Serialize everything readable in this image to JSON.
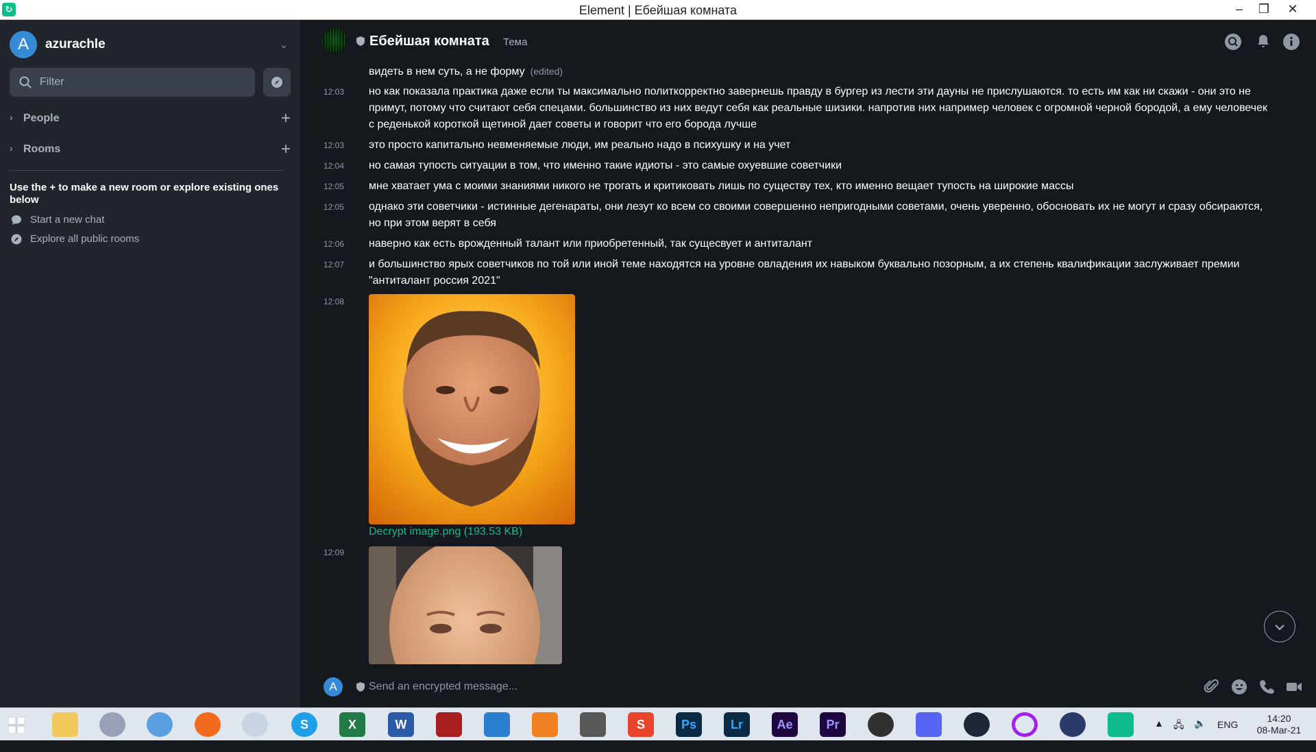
{
  "window": {
    "title": "Element | Ебейшая комната",
    "minimize": "–",
    "maximize": "❐",
    "close": "✕"
  },
  "sidebar": {
    "user": {
      "avatar_letter": "A",
      "name": "azurachle"
    },
    "filter_placeholder": "Filter",
    "sections": [
      {
        "label": "People"
      },
      {
        "label": "Rooms"
      }
    ],
    "hint": "Use the + to make a new room or explore existing ones below",
    "links": [
      {
        "label": "Start a new chat",
        "icon": "chat-bubble-icon"
      },
      {
        "label": "Explore all public rooms",
        "icon": "compass-icon"
      }
    ]
  },
  "room": {
    "name": "Ебейшая комната",
    "topic": "Тема"
  },
  "messages": [
    {
      "time": "",
      "text": "видеть в нем суть, а не форму",
      "edited": "(edited)"
    },
    {
      "time": "12:03",
      "text": "но как показала практика даже если ты максимально политкорректно завернешь правду в бургер из лести эти дауны не прислушаются. то есть им как ни скажи - они это не примут, потому что считают себя спецами. большинство из них ведут себя как реальные шизики. напротив них например человек с огромной черной бородой, а ему человечек с реденькой короткой щетиной дает советы и говорит что его борода лучше"
    },
    {
      "time": "12:03",
      "text": "это просто капитально невменяемые люди, им реально надо в психушку и на учет"
    },
    {
      "time": "12:04",
      "text": "но самая тупость ситуации в том, что именно такие идиоты - это самые охуевшие советчики"
    },
    {
      "time": "12:05",
      "text": "мне хватает ума с моими знаниями никого не трогать и критиковать лишь по существу тех, кто именно вещает тупость на широкие массы"
    },
    {
      "time": "12:05",
      "text": "однако эти советчики - истинные дегенараты, они лезут ко всем со своими совершенно непригодными советами, очень уверенно, обосновать их не могут и сразу обсираются, но при этом верят в себя"
    },
    {
      "time": "12:06",
      "text": "наверно как есть врожденный талант или приобретенный, так сущесвует и антиталант"
    },
    {
      "time": "12:07",
      "text": "и большинство ярых советчиков по той или иной теме находятся на уровне овладения их навыком буквально позорным, а их степень квалификации заслуживает премии \"антиталант россия 2021\""
    }
  ],
  "images": [
    {
      "time": "12:08",
      "link": "Decrypt image.png (193.53 KB)"
    },
    {
      "time": "12:09"
    }
  ],
  "composer": {
    "avatar_letter": "A",
    "placeholder": "Send an encrypted message..."
  },
  "taskbar": {
    "icons": [
      "windows-start-icon",
      "file-explorer-icon",
      "qbittorrent-icon",
      "internet-icon",
      "firefox-icon",
      "globe-icon",
      "skype-icon",
      "excel-icon",
      "word-icon",
      "acrobat-icon",
      "vscode-icon",
      "vlc-icon",
      "downloader-icon",
      "s-app-icon",
      "photoshop-icon",
      "lightroom-icon",
      "after-effects-icon",
      "premiere-icon",
      "obs-icon",
      "discord-icon",
      "steam-icon",
      "cortana-ring-icon",
      "vpn-lock-icon",
      "element-icon"
    ],
    "labels": {
      "skype": "S",
      "excel": "X",
      "word": "W",
      "ps": "Ps",
      "lr": "Lr",
      "ae": "Ae",
      "pr": "Pr",
      "s_app": "S"
    },
    "language": "ENG",
    "time": "14:20",
    "date": "08-Mar-21"
  },
  "colors": {
    "accent": "#0dbd8b",
    "sidebar_bg": "#21262c",
    "timeline_bg": "#15191e",
    "avatar_blue": "#368bd6"
  }
}
